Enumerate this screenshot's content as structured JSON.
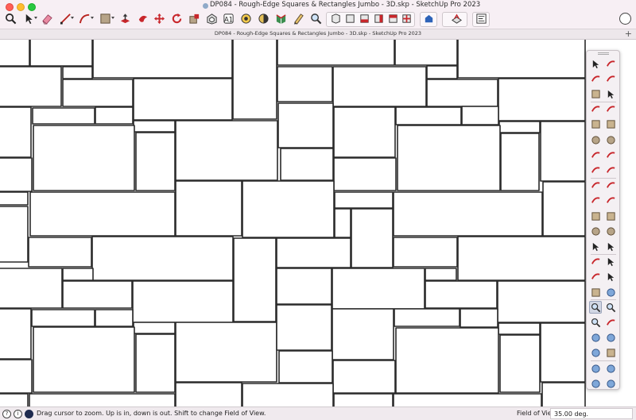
{
  "window": {
    "title": "DP084 - Rough-Edge Squares & Rectangles Jumbo - 3D.skp - SketchUp Pro 2023"
  },
  "tab": {
    "title": "DP084 - Rough-Edge Squares & Rectangles Jumbo - 3D.skp - SketchUp Pro 2023",
    "add_label": "+"
  },
  "toolbar": {
    "tools": [
      "search-icon",
      "select-icon",
      "eraser-icon",
      "line-icon",
      "arc-icon",
      "push-pull-icon",
      "paint-icon",
      "move-icon",
      "rotate-icon",
      "scale-icon",
      "offset-icon",
      "follow-me-icon",
      "tape-icon",
      "text-icon",
      "protractor-icon",
      "axes-icon",
      "section-icon",
      "zoom-icon"
    ],
    "view_group": [
      "iso-view-icon",
      "top-view-icon",
      "front-view-icon",
      "right-view-icon",
      "back-view-icon",
      "left-view-icon"
    ],
    "extras": [
      "warehouse-icon",
      "extension-warehouse-icon",
      "layout-icon"
    ]
  },
  "palette": {
    "rows": [
      [
        "select-icon",
        "orbit-icon"
      ],
      [
        "paint-bucket-icon",
        "eraser-icon"
      ],
      [
        "component-icon",
        "tag-icon"
      ],
      [
        "line-icon",
        "freehand-icon"
      ],
      [
        "rectangle-icon",
        "rotated-rectangle-icon"
      ],
      [
        "circle-icon",
        "polygon-icon"
      ],
      [
        "arc-icon",
        "two-point-arc-icon"
      ],
      [
        "three-point-arc-icon",
        "pie-icon"
      ],
      [
        "move-icon",
        "push-pull-icon"
      ],
      [
        "rotate-icon",
        "follow-me-icon"
      ],
      [
        "scale-icon",
        "offset-icon"
      ],
      [
        "outer-shell-icon",
        "solid-tools-icon"
      ],
      [
        "tape-measure-icon",
        "dimension-icon"
      ],
      [
        "protractor-icon",
        "text-icon"
      ],
      [
        "axes-icon",
        "3d-text-icon"
      ],
      [
        "section-plane-icon",
        "walk-icon"
      ],
      [
        "zoom-icon",
        "zoom-window-icon"
      ],
      [
        "zoom-extents-icon",
        "previous-view-icon"
      ],
      [
        "position-camera-icon",
        "look-around-icon"
      ],
      [
        "walk-through-icon",
        "section-display-icon"
      ],
      [
        "sandbox-icon",
        "smoove-icon"
      ],
      [
        "stamp-icon",
        "drape-icon"
      ]
    ],
    "selected": "zoom-icon"
  },
  "statusbar": {
    "message": "Drag cursor to zoom.  Up is in, down is out. Shift to change Field of View.",
    "measure_label": "Field of View",
    "measure_value": "35.00 deg."
  },
  "colors": {
    "stroke": "#2a2a2a",
    "titlebar": "#f7eff4",
    "canvas": "#ffffff",
    "accent_red": "#c8262b",
    "accent_blue": "#2d63b8"
  }
}
